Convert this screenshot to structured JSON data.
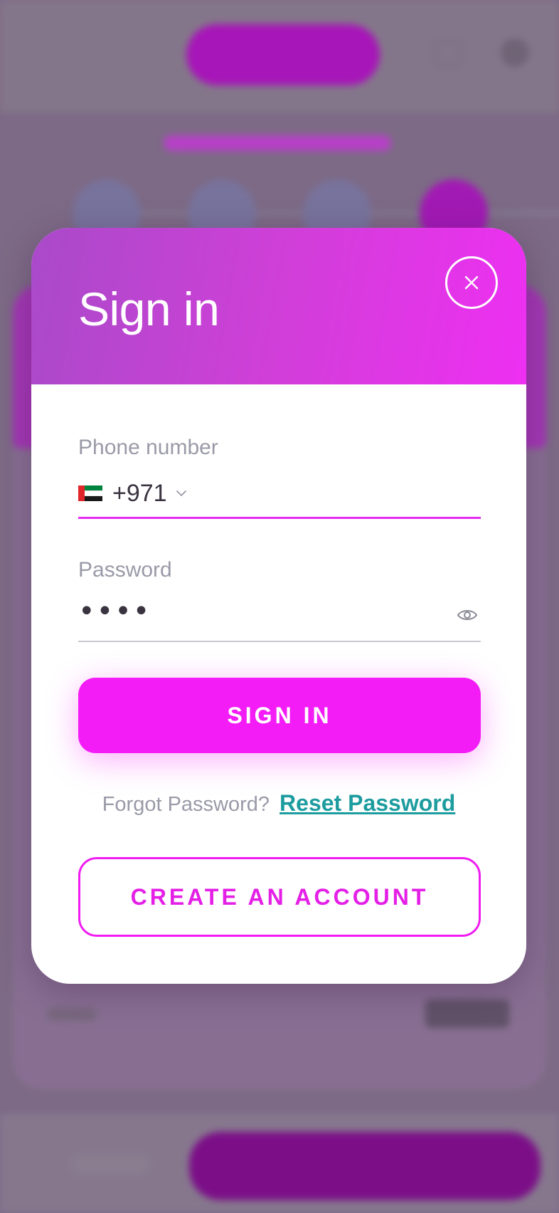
{
  "modal": {
    "title": "Sign in",
    "close_icon": "close-icon",
    "gradient_colors": [
      "#a94ac9",
      "#ee2ff2"
    ]
  },
  "phone": {
    "label": "Phone number",
    "country_flag": "uae-flag-icon",
    "country_code": "+971",
    "dropdown_icon": "chevron-down-icon"
  },
  "password": {
    "label": "Password",
    "value": "••••",
    "visibility_icon": "eye-icon"
  },
  "actions": {
    "sign_in_label": "SIGN IN",
    "forgot_text": "Forgot Password?",
    "reset_link": "Reset Password",
    "create_account_label": "CREATE AN ACCOUNT"
  },
  "colors": {
    "accent": "#f41cf6",
    "link": "#1d9c9f",
    "label": "#9a9aa8"
  }
}
